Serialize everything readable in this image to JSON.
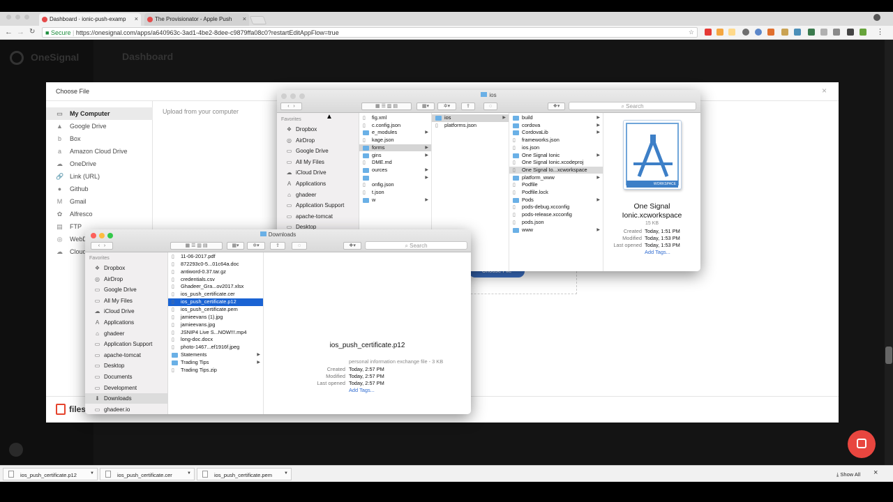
{
  "browser": {
    "tabs": [
      {
        "title": "Dashboard · ionic-push-examp",
        "close": "×"
      },
      {
        "title": "The Provisionator - Apple Push",
        "close": "×"
      }
    ],
    "secure_label": "Secure",
    "url": "https://onesignal.com/apps/a640963c-3ad1-4be2-8dee-c9879ffa08c0?restartEditAppFlow=true"
  },
  "app": {
    "brand": "OneSignal",
    "page_title": "Dashboard",
    "intercom_color": "#e8463f"
  },
  "modal": {
    "title": "Choose File",
    "close": "×",
    "upload_text": "Upload from your computer",
    "choose_button": "Choose File",
    "brand": "files",
    "sources": [
      {
        "label": "My Computer",
        "icon": "computer-icon"
      },
      {
        "label": "Google Drive",
        "icon": "google-drive-icon"
      },
      {
        "label": "Box",
        "icon": "box-icon"
      },
      {
        "label": "Amazon Cloud Drive",
        "icon": "amazon-icon"
      },
      {
        "label": "OneDrive",
        "icon": "onedrive-icon"
      },
      {
        "label": "Link (URL)",
        "icon": "link-icon"
      },
      {
        "label": "Github",
        "icon": "github-icon"
      },
      {
        "label": "Gmail",
        "icon": "gmail-icon"
      },
      {
        "label": "Alfresco",
        "icon": "alfresco-icon"
      },
      {
        "label": "FTP",
        "icon": "ftp-icon"
      },
      {
        "label": "WebD",
        "icon": "webdav-icon"
      },
      {
        "label": "Cloud",
        "icon": "cloud-icon"
      }
    ]
  },
  "finder_back": {
    "title": "ios",
    "search_placeholder": "Search",
    "favorites_label": "Favorites",
    "favorites": [
      "Dropbox",
      "AirDrop",
      "Google Drive",
      "All My Files",
      "iCloud Drive",
      "Applications",
      "ghadeer",
      "Application Support",
      "apache-tomcat",
      "Desktop"
    ],
    "col1": [
      {
        "name": "fig.xml",
        "arrow": false
      },
      {
        "name": "c.config.json",
        "arrow": false
      },
      {
        "name": "e_modules",
        "arrow": true
      },
      {
        "name": "kage.json",
        "arrow": false
      },
      {
        "name": "forms",
        "arrow": true
      },
      {
        "name": "gins",
        "arrow": true
      },
      {
        "name": "DME.md",
        "arrow": false
      },
      {
        "name": "ources",
        "arrow": true
      },
      {
        "name": "",
        "arrow": true
      },
      {
        "name": "onfig.json",
        "arrow": false
      },
      {
        "name": "t.json",
        "arrow": false
      },
      {
        "name": "w",
        "arrow": true
      }
    ],
    "col2": [
      {
        "name": "ios",
        "arrow": true
      },
      {
        "name": "platforms.json",
        "arrow": false
      }
    ],
    "col3": [
      {
        "name": "build",
        "arrow": true
      },
      {
        "name": "cordova",
        "arrow": true
      },
      {
        "name": "CordovaLib",
        "arrow": true
      },
      {
        "name": "frameworks.json",
        "arrow": false
      },
      {
        "name": "ios.json",
        "arrow": false
      },
      {
        "name": "One Signal Ionic",
        "arrow": true
      },
      {
        "name": "One Signal Ionic.xcodeproj",
        "arrow": false
      },
      {
        "name": "One Signal Io...xcworkspace",
        "arrow": false
      },
      {
        "name": "platform_www",
        "arrow": true
      },
      {
        "name": "Podfile",
        "arrow": false
      },
      {
        "name": "Podfile.lock",
        "arrow": false
      },
      {
        "name": "Pods",
        "arrow": true
      },
      {
        "name": "pods-debug.xcconfig",
        "arrow": false
      },
      {
        "name": "pods-release.xcconfig",
        "arrow": false
      },
      {
        "name": "pods.json",
        "arrow": false
      },
      {
        "name": "www",
        "arrow": true
      }
    ],
    "preview": {
      "icon_label": "WORKSPACE",
      "name_line1": "One Signal",
      "name_line2": "Ionic.xcworkspace",
      "size": "15 KB",
      "created_label": "Created",
      "created": "Today, 1:51 PM",
      "modified_label": "Modified",
      "modified": "Today, 1:53 PM",
      "opened_label": "Last opened",
      "opened": "Today, 1:53 PM",
      "add_tags": "Add Tags..."
    }
  },
  "finder_front": {
    "title": "Downloads",
    "search_placeholder": "Search",
    "favorites_label": "Favorites",
    "favorites": [
      "Dropbox",
      "AirDrop",
      "Google Drive",
      "All My Files",
      "iCloud Drive",
      "Applications",
      "ghadeer",
      "Application Support",
      "apache-tomcat",
      "Desktop",
      "Documents",
      "Development",
      "Downloads",
      "ghadeer.io"
    ],
    "files": [
      {
        "name": "11-06-2017.pdf",
        "arrow": false
      },
      {
        "name": "872293c0-5...01c64a.doc",
        "arrow": false
      },
      {
        "name": "antiword-0.37.tar.gz",
        "arrow": false
      },
      {
        "name": "credentials.csv",
        "arrow": false
      },
      {
        "name": "Ghadeer_Gra...ov2017.xlsx",
        "arrow": false
      },
      {
        "name": "ios_push_certificate.cer",
        "arrow": false
      },
      {
        "name": "ios_push_certificate.p12",
        "arrow": false
      },
      {
        "name": "ios_push_certificate.pem",
        "arrow": false
      },
      {
        "name": "jamieevans (1).jpg",
        "arrow": false
      },
      {
        "name": "jamieevans.jpg",
        "arrow": false
      },
      {
        "name": "JSNIP4 Live S...NOW!!!.mp4",
        "arrow": false
      },
      {
        "name": "long-doc.docx",
        "arrow": false
      },
      {
        "name": "photo-1467...ef1916f.jpeg",
        "arrow": false
      },
      {
        "name": "Statements",
        "arrow": true
      },
      {
        "name": "Trading Tips",
        "arrow": true
      },
      {
        "name": "Trading Tips.zip",
        "arrow": false
      }
    ],
    "preview": {
      "name": "ios_push_certificate.p12",
      "kind": "personal information exchange file - 3 KB",
      "created_label": "Created",
      "created": "Today, 2:57 PM",
      "modified_label": "Modified",
      "modified": "Today, 2:57 PM",
      "opened_label": "Last opened",
      "opened": "Today, 2:57 PM",
      "add_tags": "Add Tags..."
    }
  },
  "downloads_bar": {
    "items": [
      "ios_push_certificate.p12",
      "ios_push_certificate.cer",
      "ios_push_certificate.pem"
    ],
    "show_all": "Show All",
    "close": "×"
  }
}
